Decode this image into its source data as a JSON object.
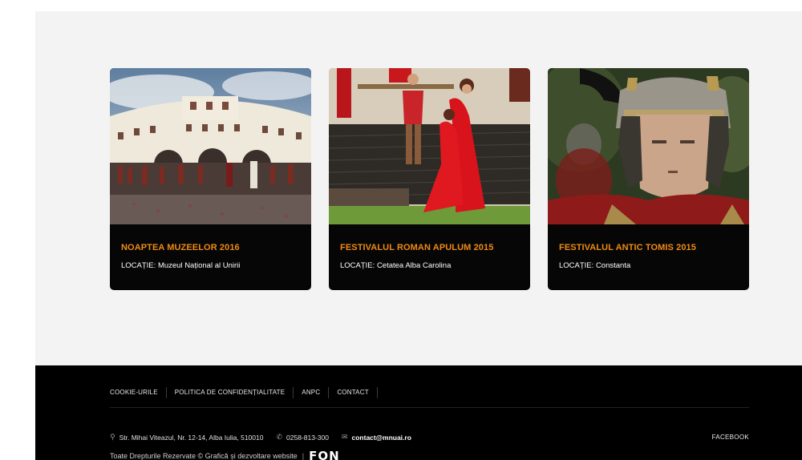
{
  "cards": [
    {
      "title": "NOAPTEA MUZEELOR 2016",
      "location_label": "LOCAȚIE:",
      "location": "Muzeul Național al Unirii",
      "image_icon": "museum-event-photo"
    },
    {
      "title": "FESTIVALUL ROMAN APULUM 2015",
      "location_label": "LOCAȚIE:",
      "location": "Cetatea Alba Carolina",
      "image_icon": "roman-festival-photo"
    },
    {
      "title": "FESTIVALUL ANTIC TOMIS 2015",
      "location_label": "LOCAȚIE:",
      "location": "Constanta",
      "image_icon": "roman-soldier-photo"
    }
  ],
  "footer": {
    "nav": [
      "COOKIE-URILE",
      "POLITICA DE CONFIDENȚIALITATE",
      "ANPC",
      "CONTACT"
    ],
    "address": "Str. Mihai Viteazul, Nr. 12-14, Alba Iulia, 510010",
    "phone": "0258-813-300",
    "email": "contact@mnuai.ro",
    "facebook": "FACEBOOK",
    "copyright": "Toate Drepturile Rezervate © Grafică și dezvoltare website",
    "separator": "|",
    "logo": "FON",
    "icons": {
      "address": "map-pin-icon",
      "phone": "phone-icon",
      "email": "envelope-icon"
    }
  },
  "colors": {
    "accent": "#f08a12",
    "card_bg": "#060606",
    "footer_bg": "#000000",
    "page_bg": "#f3f3f3"
  }
}
